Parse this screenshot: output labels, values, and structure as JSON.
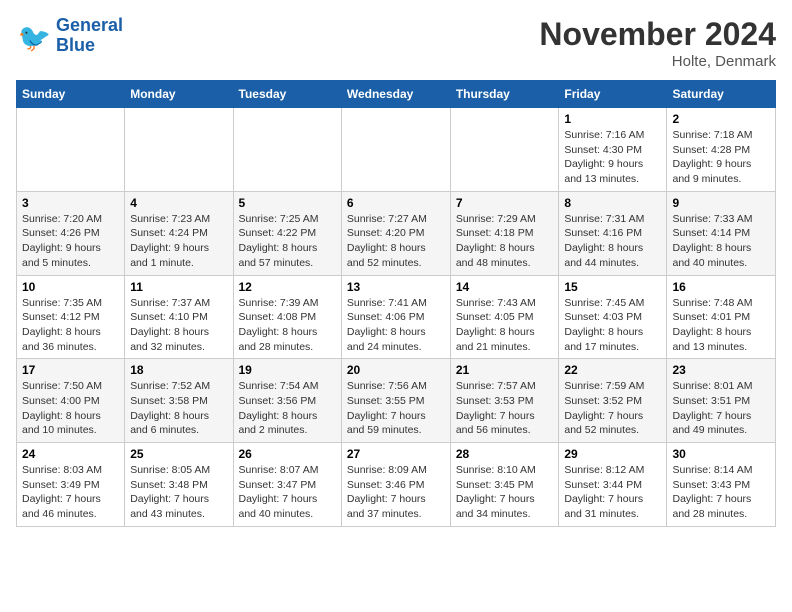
{
  "header": {
    "logo_text_general": "General",
    "logo_text_blue": "Blue",
    "month_title": "November 2024",
    "location": "Holte, Denmark"
  },
  "days_of_week": [
    "Sunday",
    "Monday",
    "Tuesday",
    "Wednesday",
    "Thursday",
    "Friday",
    "Saturday"
  ],
  "weeks": [
    [
      {
        "day": "",
        "detail": ""
      },
      {
        "day": "",
        "detail": ""
      },
      {
        "day": "",
        "detail": ""
      },
      {
        "day": "",
        "detail": ""
      },
      {
        "day": "",
        "detail": ""
      },
      {
        "day": "1",
        "detail": "Sunrise: 7:16 AM\nSunset: 4:30 PM\nDaylight: 9 hours and 13 minutes."
      },
      {
        "day": "2",
        "detail": "Sunrise: 7:18 AM\nSunset: 4:28 PM\nDaylight: 9 hours and 9 minutes."
      }
    ],
    [
      {
        "day": "3",
        "detail": "Sunrise: 7:20 AM\nSunset: 4:26 PM\nDaylight: 9 hours and 5 minutes."
      },
      {
        "day": "4",
        "detail": "Sunrise: 7:23 AM\nSunset: 4:24 PM\nDaylight: 9 hours and 1 minute."
      },
      {
        "day": "5",
        "detail": "Sunrise: 7:25 AM\nSunset: 4:22 PM\nDaylight: 8 hours and 57 minutes."
      },
      {
        "day": "6",
        "detail": "Sunrise: 7:27 AM\nSunset: 4:20 PM\nDaylight: 8 hours and 52 minutes."
      },
      {
        "day": "7",
        "detail": "Sunrise: 7:29 AM\nSunset: 4:18 PM\nDaylight: 8 hours and 48 minutes."
      },
      {
        "day": "8",
        "detail": "Sunrise: 7:31 AM\nSunset: 4:16 PM\nDaylight: 8 hours and 44 minutes."
      },
      {
        "day": "9",
        "detail": "Sunrise: 7:33 AM\nSunset: 4:14 PM\nDaylight: 8 hours and 40 minutes."
      }
    ],
    [
      {
        "day": "10",
        "detail": "Sunrise: 7:35 AM\nSunset: 4:12 PM\nDaylight: 8 hours and 36 minutes."
      },
      {
        "day": "11",
        "detail": "Sunrise: 7:37 AM\nSunset: 4:10 PM\nDaylight: 8 hours and 32 minutes."
      },
      {
        "day": "12",
        "detail": "Sunrise: 7:39 AM\nSunset: 4:08 PM\nDaylight: 8 hours and 28 minutes."
      },
      {
        "day": "13",
        "detail": "Sunrise: 7:41 AM\nSunset: 4:06 PM\nDaylight: 8 hours and 24 minutes."
      },
      {
        "day": "14",
        "detail": "Sunrise: 7:43 AM\nSunset: 4:05 PM\nDaylight: 8 hours and 21 minutes."
      },
      {
        "day": "15",
        "detail": "Sunrise: 7:45 AM\nSunset: 4:03 PM\nDaylight: 8 hours and 17 minutes."
      },
      {
        "day": "16",
        "detail": "Sunrise: 7:48 AM\nSunset: 4:01 PM\nDaylight: 8 hours and 13 minutes."
      }
    ],
    [
      {
        "day": "17",
        "detail": "Sunrise: 7:50 AM\nSunset: 4:00 PM\nDaylight: 8 hours and 10 minutes."
      },
      {
        "day": "18",
        "detail": "Sunrise: 7:52 AM\nSunset: 3:58 PM\nDaylight: 8 hours and 6 minutes."
      },
      {
        "day": "19",
        "detail": "Sunrise: 7:54 AM\nSunset: 3:56 PM\nDaylight: 8 hours and 2 minutes."
      },
      {
        "day": "20",
        "detail": "Sunrise: 7:56 AM\nSunset: 3:55 PM\nDaylight: 7 hours and 59 minutes."
      },
      {
        "day": "21",
        "detail": "Sunrise: 7:57 AM\nSunset: 3:53 PM\nDaylight: 7 hours and 56 minutes."
      },
      {
        "day": "22",
        "detail": "Sunrise: 7:59 AM\nSunset: 3:52 PM\nDaylight: 7 hours and 52 minutes."
      },
      {
        "day": "23",
        "detail": "Sunrise: 8:01 AM\nSunset: 3:51 PM\nDaylight: 7 hours and 49 minutes."
      }
    ],
    [
      {
        "day": "24",
        "detail": "Sunrise: 8:03 AM\nSunset: 3:49 PM\nDaylight: 7 hours and 46 minutes."
      },
      {
        "day": "25",
        "detail": "Sunrise: 8:05 AM\nSunset: 3:48 PM\nDaylight: 7 hours and 43 minutes."
      },
      {
        "day": "26",
        "detail": "Sunrise: 8:07 AM\nSunset: 3:47 PM\nDaylight: 7 hours and 40 minutes."
      },
      {
        "day": "27",
        "detail": "Sunrise: 8:09 AM\nSunset: 3:46 PM\nDaylight: 7 hours and 37 minutes."
      },
      {
        "day": "28",
        "detail": "Sunrise: 8:10 AM\nSunset: 3:45 PM\nDaylight: 7 hours and 34 minutes."
      },
      {
        "day": "29",
        "detail": "Sunrise: 8:12 AM\nSunset: 3:44 PM\nDaylight: 7 hours and 31 minutes."
      },
      {
        "day": "30",
        "detail": "Sunrise: 8:14 AM\nSunset: 3:43 PM\nDaylight: 7 hours and 28 minutes."
      }
    ]
  ]
}
